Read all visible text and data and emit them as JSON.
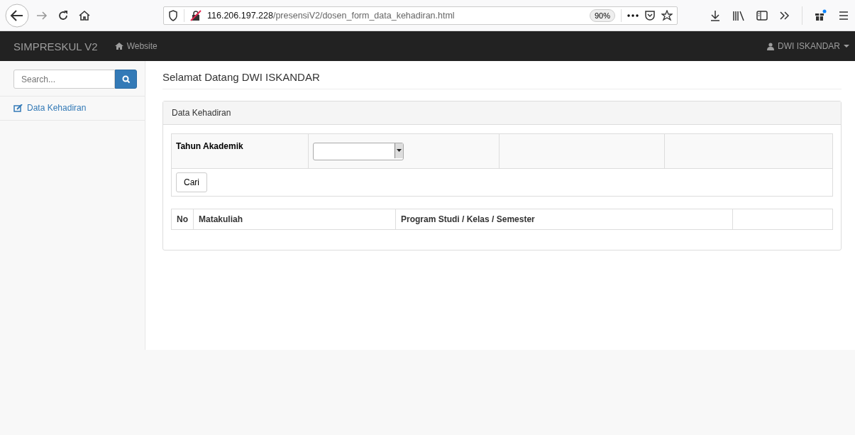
{
  "browser": {
    "url_host": "116.206.197.228",
    "url_path": "/presensiV2/dosen_form_data_kehadiran.html",
    "zoom": "90%"
  },
  "navbar": {
    "brand": "SIMPRESKUL V2",
    "link": "Website",
    "user": "DWI ISKANDAR"
  },
  "sidebar": {
    "search": {
      "placeholder": "Search..."
    },
    "items": [
      {
        "label": "Data Kehadiran"
      }
    ]
  },
  "heading": "Selamat Datang DWI ISKANDAR",
  "panel": {
    "title": "Data Kehadiran",
    "filter_label": "Tahun Akademik",
    "button": "Cari",
    "table": {
      "columns": [
        "No",
        "Matakuliah",
        "Program Studi / Kelas / Semester"
      ]
    }
  }
}
